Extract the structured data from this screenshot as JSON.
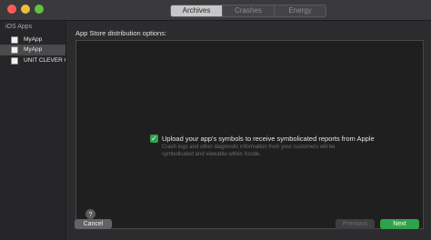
{
  "window": {
    "controls": [
      "close",
      "minimize",
      "maximize"
    ]
  },
  "tabs": [
    {
      "label": "Archives",
      "active": true
    },
    {
      "label": "Crashes",
      "active": false
    },
    {
      "label": "Energy",
      "active": false
    }
  ],
  "sidebar": {
    "section": "iOS Apps",
    "items": [
      {
        "label": "MyApp",
        "selected": false
      },
      {
        "label": "MyApp",
        "selected": true
      },
      {
        "label": "UNIT CLEVER G",
        "selected": false
      }
    ]
  },
  "main": {
    "title": "App Store distribution options:",
    "upload_option": {
      "checked": true,
      "label": "Upload your app's symbols to receive symbolicated reports from Apple",
      "description": "Crash logs and other diagnostic information from your customers will be symbolicated and viewable within Xcode."
    },
    "help": "?"
  },
  "buttons": {
    "cancel": "Cancel",
    "previous": "Previous",
    "next": "Next"
  },
  "colors": {
    "accent_green": "#30a14e",
    "close": "#fc5b57",
    "minimize": "#e5bf3c",
    "maximize": "#5fc43f"
  }
}
